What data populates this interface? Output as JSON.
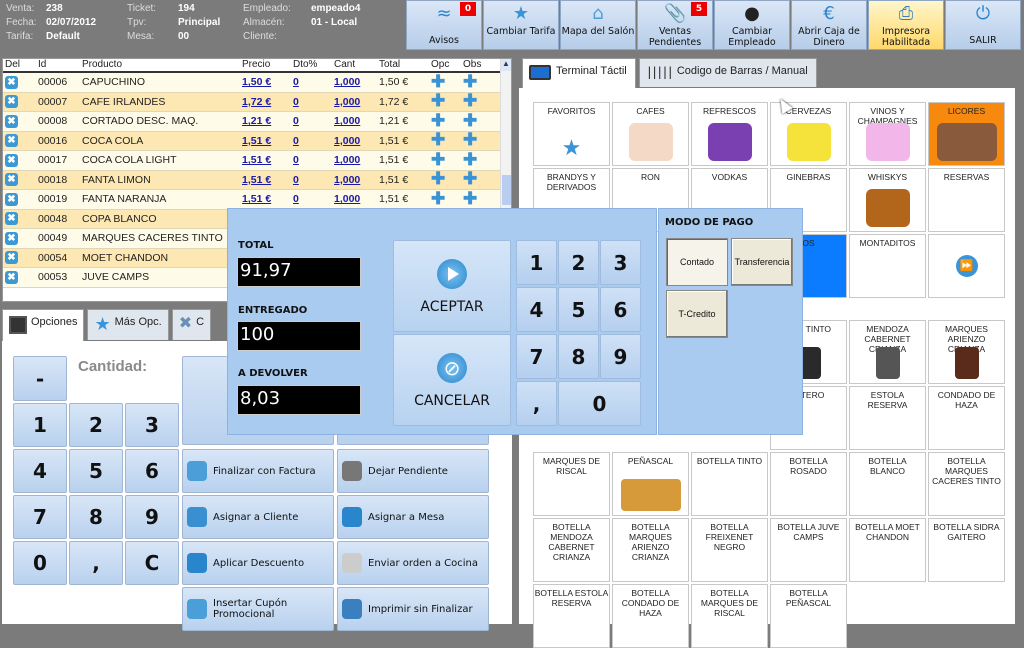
{
  "info": {
    "venta_label": "Venta:",
    "venta": "238",
    "fecha_label": "Fecha:",
    "fecha": "02/07/2012",
    "tarifa_label": "Tarifa:",
    "tarifa": "Default",
    "ticket_label": "Ticket:",
    "ticket": "194",
    "tpv_label": "Tpv:",
    "tpv": "Principal",
    "mesa_label": "Mesa:",
    "mesa": "00",
    "empleado_label": "Empleado:",
    "empleado": "empeado4",
    "almacen_label": "Almacén:",
    "almacen": "01 - Local",
    "cliente_label": "Cliente:",
    "cliente": ""
  },
  "toolbar": [
    {
      "label": "Avisos",
      "icon": "rss-icon",
      "badge": "0"
    },
    {
      "label": "Cambiar Tarifa",
      "icon": "star-icon"
    },
    {
      "label": "Mapa del Salón",
      "icon": "home-icon"
    },
    {
      "label": "Ventas Pendientes",
      "icon": "paperclip-icon",
      "badge": "5"
    },
    {
      "label": "Cambiar Empleado",
      "icon": "user-icon"
    },
    {
      "label": "Abrir Caja de Dinero",
      "icon": "euro-icon"
    },
    {
      "label": "Impresora Habilitada",
      "icon": "printer-icon",
      "highlighted": true
    },
    {
      "label": "SALIR",
      "icon": "power-icon"
    }
  ],
  "order": {
    "columns": [
      "Del",
      "Id",
      "Producto",
      "Precio",
      "Dto%",
      "Cant",
      "Total",
      "Opc",
      "Obs"
    ],
    "rows": [
      {
        "id": "00006",
        "producto": "CAPUCHINO",
        "precio": "1,50 €",
        "dto": "0",
        "cant": "1,000",
        "total": "1,50 €"
      },
      {
        "id": "00007",
        "producto": "CAFE IRLANDES",
        "precio": "1,72 €",
        "dto": "0",
        "cant": "1,000",
        "total": "1,72 €"
      },
      {
        "id": "00008",
        "producto": "CORTADO DESC. MAQ.",
        "precio": "1,21 €",
        "dto": "0",
        "cant": "1,000",
        "total": "1,21 €"
      },
      {
        "id": "00016",
        "producto": "COCA COLA",
        "precio": "1,51 €",
        "dto": "0",
        "cant": "1,000",
        "total": "1,51 €"
      },
      {
        "id": "00017",
        "producto": "COCA COLA LIGHT",
        "precio": "1,51 €",
        "dto": "0",
        "cant": "1,000",
        "total": "1,51 €"
      },
      {
        "id": "00018",
        "producto": "FANTA LIMON",
        "precio": "1,51 €",
        "dto": "0",
        "cant": "1,000",
        "total": "1,51 €"
      },
      {
        "id": "00019",
        "producto": "FANTA NARANJA",
        "precio": "1,51 €",
        "dto": "0",
        "cant": "1,000",
        "total": "1,51 €"
      },
      {
        "id": "00048",
        "producto": "COPA BLANCO",
        "precio": "",
        "dto": "",
        "cant": "",
        "total": ""
      },
      {
        "id": "00049",
        "producto": "MARQUES CACERES TINTO",
        "precio": "",
        "dto": "",
        "cant": "",
        "total": ""
      },
      {
        "id": "00054",
        "producto": "MOET CHANDON",
        "precio": "",
        "dto": "",
        "cant": "",
        "total": ""
      },
      {
        "id": "00053",
        "producto": "JUVE CAMPS",
        "precio": "",
        "dto": "",
        "cant": "",
        "total": ""
      }
    ]
  },
  "left_tabs": [
    "Opciones",
    "Más Opc.",
    "C"
  ],
  "cantidad_label": "Cantidad:",
  "keypad": {
    "minus": "-",
    "keys": [
      "1",
      "2",
      "3",
      "4",
      "5",
      "6",
      "7",
      "8",
      "9",
      "0",
      ",",
      "C"
    ]
  },
  "actions": [
    {
      "label": "Finalizar con Factura",
      "icon": "invoice-icon"
    },
    {
      "label": "Dejar Pendiente",
      "icon": "paperclip-icon"
    },
    {
      "label": "Asignar a Cliente",
      "icon": "address-book-icon"
    },
    {
      "label": "Asignar a Mesa",
      "icon": "puzzle-icon"
    },
    {
      "label": "Aplicar Descuento",
      "icon": "piggy-bank-icon"
    },
    {
      "label": "Enviar orden a Cocina",
      "icon": "receipt-icon"
    },
    {
      "label": "Insertar Cupón Promocional",
      "icon": "coupon-icon"
    },
    {
      "label": "Imprimir sin Finalizar",
      "icon": "printer-icon"
    }
  ],
  "right_tabs": [
    "Terminal Táctil",
    "Codigo de Barras / Manual"
  ],
  "categories": [
    "FAVORITOS",
    "CAFES",
    "REFRESCOS",
    "CERVEZAS",
    "VINOS Y CHAMPAGNES",
    "LICORES",
    "BRANDYS Y DERIVADOS",
    "RON",
    "VODKAS",
    "GINEBRAS",
    "WHISKYS",
    "RESERVAS",
    "",
    "",
    "",
    "OS",
    "MONTADITOS",
    ""
  ],
  "products": [
    "",
    "",
    "",
    "UES TINTO",
    "MENDOZA CABERNET CRIANZA",
    "MARQUES ARIENZO CRIANZA",
    "",
    "",
    "",
    "AITERO",
    "ESTOLA RESERVA",
    "CONDADO DE HAZA",
    "MARQUES DE RISCAL",
    "PEÑASCAL",
    "BOTELLA TINTO",
    "BOTELLA ROSADO",
    "BOTELLA BLANCO",
    "BOTELLA MARQUES CACERES TINTO",
    "BOTELLA MENDOZA CABERNET CRIANZA",
    "BOTELLA MARQUES ARIENZO CRIANZA",
    "BOTELLA FREIXENET NEGRO",
    "BOTELLA JUVE CAMPS",
    "BOTELLA MOET CHANDON",
    "BOTELLA SIDRA GAITERO",
    "BOTELLA ESTOLA RESERVA",
    "BOTELLA CONDADO DE HAZA",
    "BOTELLA MARQUES DE RISCAL",
    "BOTELLA PEÑASCAL"
  ],
  "payment": {
    "total_label": "TOTAL",
    "total": "91,97",
    "entregado_label": "ENTREGADO",
    "entregado": "100",
    "devolver_label": "A DEVOLVER",
    "devolver": "8,03",
    "accept": "ACEPTAR",
    "cancel": "CANCELAR",
    "keys": [
      "1",
      "2",
      "3",
      "4",
      "5",
      "6",
      "7",
      "8",
      "9",
      ",",
      "0"
    ],
    "modo_title": "MODO DE PAGO",
    "modes": [
      "Contado",
      "Transferencia",
      "T-Credito"
    ],
    "selected_mode": "Contado"
  },
  "colors": {
    "selected_category": "#f7890e",
    "badge": "#ee0000",
    "highlight_button": "#ffd86a"
  }
}
